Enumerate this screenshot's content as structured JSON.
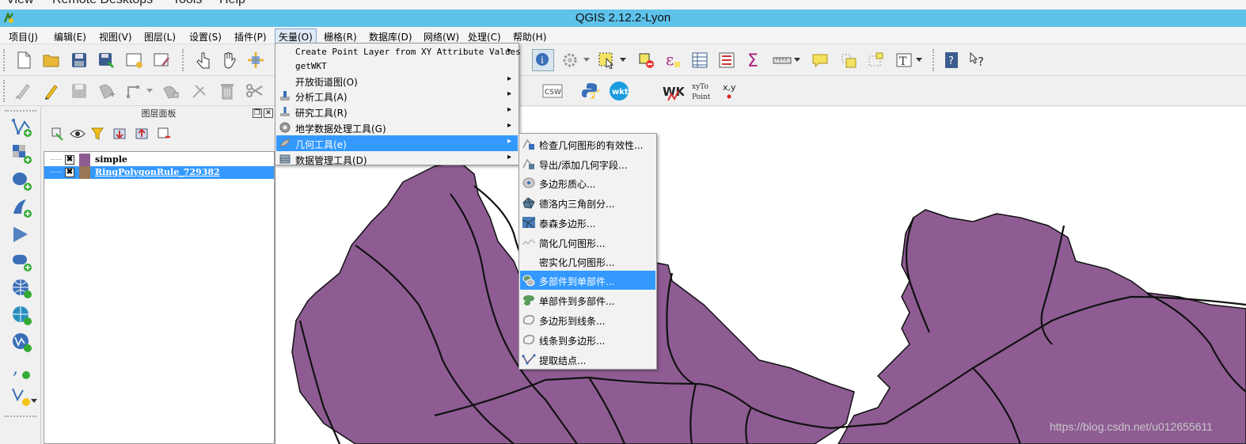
{
  "remote_menu": {
    "items": [
      "View",
      "Remote Desktops",
      "Tools",
      "Help"
    ]
  },
  "window": {
    "title": "QGIS 2.12.2-Lyon"
  },
  "menubar": {
    "items": [
      "项目(J)",
      "编辑(E)",
      "视图(V)",
      "图层(L)",
      "设置(S)",
      "插件(P)",
      "矢量(O)",
      "栅格(R)",
      "数据库(D)",
      "网络(W)",
      "处理(C)",
      "帮助(H)"
    ],
    "open_item": "矢量(O)"
  },
  "toolbar_labels": {
    "csw": "CSW",
    "wkt": "wkt",
    "wkt_big": "WKT",
    "xyto": "xyTo",
    "point": "Point",
    "xy": "x,y"
  },
  "layer_panel": {
    "title": "图层面板",
    "layers": [
      {
        "name": "simple",
        "checked": "✖",
        "color": "#8e5c93",
        "selected": false
      },
      {
        "name": "RingPolygonRule_729382",
        "checked": "✖",
        "color": "#9a7654",
        "selected": true
      }
    ]
  },
  "vector_menu": {
    "items": [
      {
        "label": "Create Point Layer from XY Attribute Values",
        "icon": "none",
        "submenu": true,
        "mono": true
      },
      {
        "label": "getWKT",
        "icon": "none",
        "submenu": false,
        "mono": true
      },
      {
        "label": "开放街道图(O)",
        "icon": "none",
        "submenu": true,
        "mono": false
      },
      {
        "label": "分析工具(A)",
        "icon": "analysis-icon",
        "submenu": true,
        "mono": false
      },
      {
        "label": "研究工具(R)",
        "icon": "research-icon",
        "submenu": true,
        "mono": false
      },
      {
        "label": "地学数据处理工具(G)",
        "icon": "geoprocessing-icon",
        "submenu": true,
        "mono": false
      },
      {
        "label": "几何工具(e)",
        "icon": "geometry-icon",
        "submenu": true,
        "mono": false,
        "highlighted": true
      },
      {
        "label": "数据管理工具(D)",
        "icon": "data-management-icon",
        "submenu": true,
        "mono": false
      }
    ]
  },
  "geometry_submenu": {
    "items": [
      {
        "label": "检查几何图形的有效性...",
        "icon": "check-validity-icon"
      },
      {
        "label": "导出/添加几何字段...",
        "icon": "export-geometry-icon"
      },
      {
        "label": "多边形质心...",
        "icon": "centroid-icon"
      },
      {
        "label": "德洛内三角剖分...",
        "icon": "delaunay-icon"
      },
      {
        "label": "泰森多边形...",
        "icon": "voronoi-icon"
      },
      {
        "label": "简化几何图形...",
        "icon": "simplify-icon"
      },
      {
        "label": "密实化几何图形...",
        "icon": "none"
      },
      {
        "label": "多部件到单部件...",
        "icon": "multipart-to-single-icon",
        "highlighted": true
      },
      {
        "label": "单部件到多部件...",
        "icon": "single-to-multipart-icon"
      },
      {
        "label": "多边形到线条...",
        "icon": "polygon-to-line-icon"
      },
      {
        "label": "线条到多边形...",
        "icon": "line-to-polygon-icon"
      },
      {
        "label": "提取结点...",
        "icon": "extract-nodes-icon"
      }
    ]
  },
  "colors": {
    "titlebar": "#5ec2ea",
    "highlight": "#3399ff",
    "polygon_fill": "#8e5c93"
  },
  "watermark": "https://blog.csdn.net/u012655611"
}
